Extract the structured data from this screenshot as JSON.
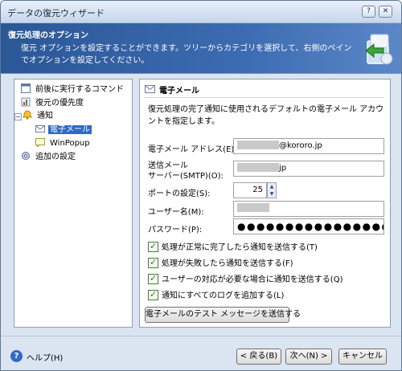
{
  "window": {
    "title": "データの復元ウィザード",
    "help_button": "?",
    "close_button": "✕"
  },
  "banner": {
    "heading": "復元処理のオプション",
    "description": "復元 オプションを設定することができます。ツリーからカテゴリを選択して、右側のペインでオプションを設定してください。"
  },
  "tree": {
    "items": [
      {
        "label": "前後に実行するコマンド",
        "icon": "command-icon"
      },
      {
        "label": "復元の優先度",
        "icon": "priority-icon"
      },
      {
        "label": "通知",
        "icon": "notification-icon",
        "expander": "−"
      },
      {
        "label": "電子メール",
        "icon": "email-icon",
        "selected": true
      },
      {
        "label": "WinPopup",
        "icon": "winpopup-icon"
      },
      {
        "label": "追加の設定",
        "icon": "settings-icon"
      }
    ]
  },
  "panel": {
    "heading": "電子メール",
    "description": "復元処理の完了通知に使用されるデフォルトの電子メール アカウントを指定します。",
    "email_label": "電子メール アドレス(E):",
    "email_value": "@kororo.jp",
    "smtp_label_line1": "送信メール",
    "smtp_label_line2": "サーバー(SMTP)(O):",
    "smtp_value": "jp",
    "port_label": "ポートの設定(S):",
    "port_value": "25",
    "username_label": "ユーザー名(M):",
    "password_label": "パスワード(P):",
    "password_value": "●●●●●●●●●●●●●●●●",
    "checkboxes": [
      {
        "label": "処理が正常に完了したら通知を送信する(T)",
        "checked": true
      },
      {
        "label": "処理が失敗したら通知を送信する(F)",
        "checked": true
      },
      {
        "label": "ユーザーの対応が必要な場合に通知を送信する(Q)",
        "checked": true
      },
      {
        "label": "通知にすべてのログを追加する(L)",
        "checked": true
      }
    ],
    "test_button": "電子メールのテスト メッセージを送信する"
  },
  "footer": {
    "help_label": "ヘルプ(H)",
    "back_button": "< 戻る(B)",
    "next_button": "次へ(N) >",
    "cancel_button": "キャンセル"
  },
  "colors": {
    "banner_bg": "#2b5797",
    "selection": "#3169c6",
    "window_bg": "#dbe4f1"
  }
}
